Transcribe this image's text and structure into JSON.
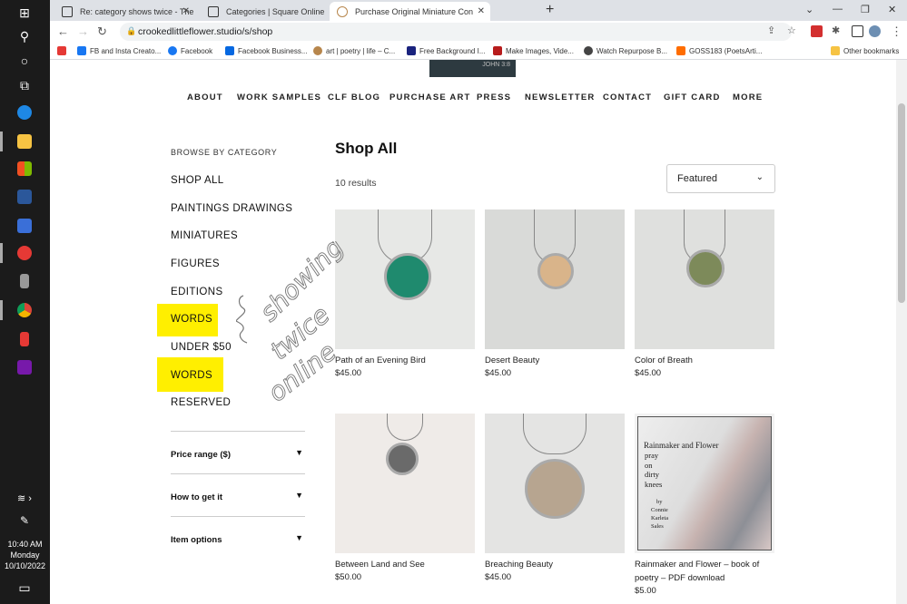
{
  "taskbar": {
    "clock_time": "10:40 AM",
    "clock_day": "Monday",
    "clock_date": "10/10/2022"
  },
  "browser": {
    "tabs": [
      {
        "label": "Re: category shows twice - The S"
      },
      {
        "label": "Categories | Square Online"
      },
      {
        "label": "Purchase Original Miniature Con"
      }
    ],
    "url": "crookedlittleflower.studio/s/shop",
    "bookmarks": [
      {
        "label": "FB and Insta Creato..."
      },
      {
        "label": "Facebook"
      },
      {
        "label": "Facebook Business..."
      },
      {
        "label": "art | poetry | life – C..."
      },
      {
        "label": "Free Background I..."
      },
      {
        "label": "Make Images, Vide..."
      },
      {
        "label": "Watch Repurpose B..."
      },
      {
        "label": "GOSS183 (PoetsArti..."
      },
      {
        "label": "Other bookmarks"
      }
    ]
  },
  "site": {
    "nav": [
      "ABOUT",
      "WORK SAMPLES",
      "CLF BLOG",
      "PURCHASE ART",
      "PRESS",
      "NEWSLETTER",
      "CONTACT",
      "GIFT CARD",
      "MORE"
    ],
    "browse_heading": "BROWSE BY CATEGORY",
    "categories": [
      "SHOP ALL",
      "PAINTINGS DRAWINGS",
      "MINIATURES",
      "FIGURES",
      "EDITIONS",
      "WORDS",
      "UNDER $50",
      "WORDS",
      "RESERVED"
    ],
    "filters": [
      "Price range ($)",
      "How to get it",
      "Item options"
    ],
    "title": "Shop All",
    "results": "10 results",
    "sort_value": "Featured"
  },
  "products": [
    {
      "name": "Path of an Evening Bird",
      "price": "$45.00",
      "color": "#1f8a6e"
    },
    {
      "name": "Desert Beauty",
      "price": "$45.00",
      "color": "#d9b48a"
    },
    {
      "name": "Color of Breath",
      "price": "$45.00",
      "color": "#7d8a5a"
    },
    {
      "name": "Between Land and See",
      "price": "$50.00",
      "color": "#6a6a6a"
    },
    {
      "name": "Breaching Beauty",
      "price": "$45.00",
      "color": "#b7a590"
    },
    {
      "name": "Rainmaker and Flower – book of poetry – PDF download",
      "price": "$5.00",
      "color": "#c8b8b5"
    }
  ],
  "book_cover": {
    "title": "Rainmaker and Flower",
    "poem": [
      "pray",
      "on",
      "dirty",
      "knees"
    ],
    "by": "by",
    "author": [
      "Connie",
      "Karleta",
      "Sales"
    ]
  },
  "annotation": {
    "text": [
      "showing",
      "twice",
      "online"
    ],
    "highlight_color": "#ffef00"
  }
}
